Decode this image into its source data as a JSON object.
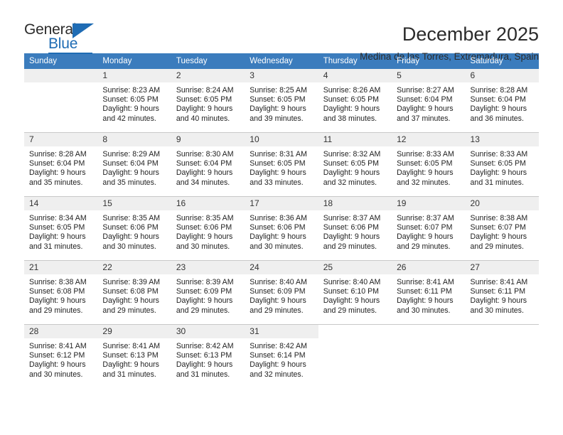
{
  "brand": {
    "name_top": "General",
    "name_bottom": "Blue"
  },
  "header": {
    "title": "December 2025",
    "subtitle": "Medina de las Torres, Extremadura, Spain"
  },
  "colors": {
    "header_bar": "#3b7cbd",
    "brand_blue": "#1f6cb4",
    "daynum_band": "#efefef",
    "grid_line": "#c8c8c8"
  },
  "weekdays": [
    "Sunday",
    "Monday",
    "Tuesday",
    "Wednesday",
    "Thursday",
    "Friday",
    "Saturday"
  ],
  "weeks": [
    [
      {
        "day": "",
        "empty": true,
        "sunrise": "",
        "sunset": "",
        "daylight1": "",
        "daylight2": ""
      },
      {
        "day": "1",
        "sunrise": "Sunrise: 8:23 AM",
        "sunset": "Sunset: 6:05 PM",
        "daylight1": "Daylight: 9 hours",
        "daylight2": "and 42 minutes."
      },
      {
        "day": "2",
        "sunrise": "Sunrise: 8:24 AM",
        "sunset": "Sunset: 6:05 PM",
        "daylight1": "Daylight: 9 hours",
        "daylight2": "and 40 minutes."
      },
      {
        "day": "3",
        "sunrise": "Sunrise: 8:25 AM",
        "sunset": "Sunset: 6:05 PM",
        "daylight1": "Daylight: 9 hours",
        "daylight2": "and 39 minutes."
      },
      {
        "day": "4",
        "sunrise": "Sunrise: 8:26 AM",
        "sunset": "Sunset: 6:05 PM",
        "daylight1": "Daylight: 9 hours",
        "daylight2": "and 38 minutes."
      },
      {
        "day": "5",
        "sunrise": "Sunrise: 8:27 AM",
        "sunset": "Sunset: 6:04 PM",
        "daylight1": "Daylight: 9 hours",
        "daylight2": "and 37 minutes."
      },
      {
        "day": "6",
        "sunrise": "Sunrise: 8:28 AM",
        "sunset": "Sunset: 6:04 PM",
        "daylight1": "Daylight: 9 hours",
        "daylight2": "and 36 minutes."
      }
    ],
    [
      {
        "day": "7",
        "sunrise": "Sunrise: 8:28 AM",
        "sunset": "Sunset: 6:04 PM",
        "daylight1": "Daylight: 9 hours",
        "daylight2": "and 35 minutes."
      },
      {
        "day": "8",
        "sunrise": "Sunrise: 8:29 AM",
        "sunset": "Sunset: 6:04 PM",
        "daylight1": "Daylight: 9 hours",
        "daylight2": "and 35 minutes."
      },
      {
        "day": "9",
        "sunrise": "Sunrise: 8:30 AM",
        "sunset": "Sunset: 6:04 PM",
        "daylight1": "Daylight: 9 hours",
        "daylight2": "and 34 minutes."
      },
      {
        "day": "10",
        "sunrise": "Sunrise: 8:31 AM",
        "sunset": "Sunset: 6:05 PM",
        "daylight1": "Daylight: 9 hours",
        "daylight2": "and 33 minutes."
      },
      {
        "day": "11",
        "sunrise": "Sunrise: 8:32 AM",
        "sunset": "Sunset: 6:05 PM",
        "daylight1": "Daylight: 9 hours",
        "daylight2": "and 32 minutes."
      },
      {
        "day": "12",
        "sunrise": "Sunrise: 8:33 AM",
        "sunset": "Sunset: 6:05 PM",
        "daylight1": "Daylight: 9 hours",
        "daylight2": "and 32 minutes."
      },
      {
        "day": "13",
        "sunrise": "Sunrise: 8:33 AM",
        "sunset": "Sunset: 6:05 PM",
        "daylight1": "Daylight: 9 hours",
        "daylight2": "and 31 minutes."
      }
    ],
    [
      {
        "day": "14",
        "sunrise": "Sunrise: 8:34 AM",
        "sunset": "Sunset: 6:05 PM",
        "daylight1": "Daylight: 9 hours",
        "daylight2": "and 31 minutes."
      },
      {
        "day": "15",
        "sunrise": "Sunrise: 8:35 AM",
        "sunset": "Sunset: 6:06 PM",
        "daylight1": "Daylight: 9 hours",
        "daylight2": "and 30 minutes."
      },
      {
        "day": "16",
        "sunrise": "Sunrise: 8:35 AM",
        "sunset": "Sunset: 6:06 PM",
        "daylight1": "Daylight: 9 hours",
        "daylight2": "and 30 minutes."
      },
      {
        "day": "17",
        "sunrise": "Sunrise: 8:36 AM",
        "sunset": "Sunset: 6:06 PM",
        "daylight1": "Daylight: 9 hours",
        "daylight2": "and 30 minutes."
      },
      {
        "day": "18",
        "sunrise": "Sunrise: 8:37 AM",
        "sunset": "Sunset: 6:06 PM",
        "daylight1": "Daylight: 9 hours",
        "daylight2": "and 29 minutes."
      },
      {
        "day": "19",
        "sunrise": "Sunrise: 8:37 AM",
        "sunset": "Sunset: 6:07 PM",
        "daylight1": "Daylight: 9 hours",
        "daylight2": "and 29 minutes."
      },
      {
        "day": "20",
        "sunrise": "Sunrise: 8:38 AM",
        "sunset": "Sunset: 6:07 PM",
        "daylight1": "Daylight: 9 hours",
        "daylight2": "and 29 minutes."
      }
    ],
    [
      {
        "day": "21",
        "sunrise": "Sunrise: 8:38 AM",
        "sunset": "Sunset: 6:08 PM",
        "daylight1": "Daylight: 9 hours",
        "daylight2": "and 29 minutes."
      },
      {
        "day": "22",
        "sunrise": "Sunrise: 8:39 AM",
        "sunset": "Sunset: 6:08 PM",
        "daylight1": "Daylight: 9 hours",
        "daylight2": "and 29 minutes."
      },
      {
        "day": "23",
        "sunrise": "Sunrise: 8:39 AM",
        "sunset": "Sunset: 6:09 PM",
        "daylight1": "Daylight: 9 hours",
        "daylight2": "and 29 minutes."
      },
      {
        "day": "24",
        "sunrise": "Sunrise: 8:40 AM",
        "sunset": "Sunset: 6:09 PM",
        "daylight1": "Daylight: 9 hours",
        "daylight2": "and 29 minutes."
      },
      {
        "day": "25",
        "sunrise": "Sunrise: 8:40 AM",
        "sunset": "Sunset: 6:10 PM",
        "daylight1": "Daylight: 9 hours",
        "daylight2": "and 29 minutes."
      },
      {
        "day": "26",
        "sunrise": "Sunrise: 8:41 AM",
        "sunset": "Sunset: 6:11 PM",
        "daylight1": "Daylight: 9 hours",
        "daylight2": "and 30 minutes."
      },
      {
        "day": "27",
        "sunrise": "Sunrise: 8:41 AM",
        "sunset": "Sunset: 6:11 PM",
        "daylight1": "Daylight: 9 hours",
        "daylight2": "and 30 minutes."
      }
    ],
    [
      {
        "day": "28",
        "sunrise": "Sunrise: 8:41 AM",
        "sunset": "Sunset: 6:12 PM",
        "daylight1": "Daylight: 9 hours",
        "daylight2": "and 30 minutes."
      },
      {
        "day": "29",
        "sunrise": "Sunrise: 8:41 AM",
        "sunset": "Sunset: 6:13 PM",
        "daylight1": "Daylight: 9 hours",
        "daylight2": "and 31 minutes."
      },
      {
        "day": "30",
        "sunrise": "Sunrise: 8:42 AM",
        "sunset": "Sunset: 6:13 PM",
        "daylight1": "Daylight: 9 hours",
        "daylight2": "and 31 minutes."
      },
      {
        "day": "31",
        "sunrise": "Sunrise: 8:42 AM",
        "sunset": "Sunset: 6:14 PM",
        "daylight1": "Daylight: 9 hours",
        "daylight2": "and 32 minutes."
      },
      {
        "day": "",
        "blank": true,
        "sunrise": "",
        "sunset": "",
        "daylight1": "",
        "daylight2": ""
      },
      {
        "day": "",
        "blank": true,
        "sunrise": "",
        "sunset": "",
        "daylight1": "",
        "daylight2": ""
      },
      {
        "day": "",
        "blank": true,
        "sunrise": "",
        "sunset": "",
        "daylight1": "",
        "daylight2": ""
      }
    ]
  ]
}
